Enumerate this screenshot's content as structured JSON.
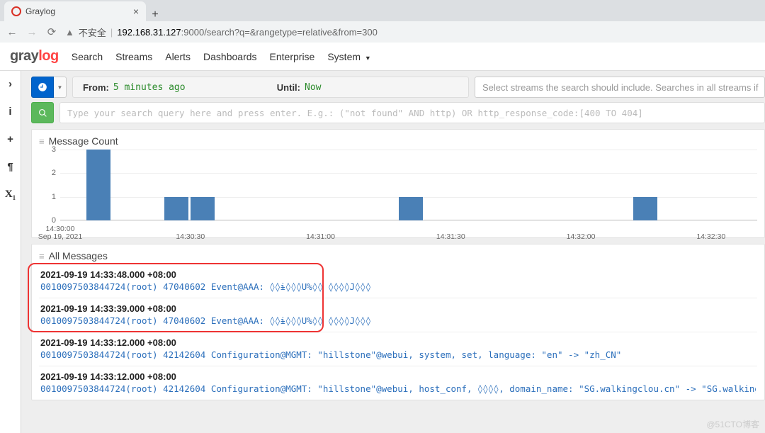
{
  "browser": {
    "tab_title": "Graylog",
    "security_label": "不安全",
    "url_host": "192.168.31.127",
    "url_port_path": ":9000/search?q=&rangetype=relative&from=300"
  },
  "brand": {
    "part1": "gray",
    "part2": "log"
  },
  "nav": {
    "search": "Search",
    "streams": "Streams",
    "alerts": "Alerts",
    "dashboards": "Dashboards",
    "enterprise": "Enterprise",
    "system": "System"
  },
  "timerange": {
    "from_label": "From:",
    "from_value": "5 minutes ago",
    "until_label": "Until:",
    "until_value": "Now"
  },
  "streams_placeholder": "Select streams the search should include. Searches in all streams if",
  "query_placeholder": "Type your search query here and press enter. E.g.: (\"not found\" AND http) OR http_response_code:[400 TO 404]",
  "panels": {
    "message_count": "Message Count",
    "all_messages": "All Messages"
  },
  "chart_data": {
    "type": "bar",
    "title": "Message Count",
    "ylabel": "",
    "ylim": [
      0,
      3
    ],
    "yticks": [
      0,
      1,
      2,
      3
    ],
    "x_date": "Sep 19, 2021",
    "xticks": [
      "14:30:00",
      "14:30:30",
      "14:31:00",
      "14:31:30",
      "14:32:00",
      "14:32:30"
    ],
    "bars": [
      {
        "x": "14:30:06",
        "value": 3
      },
      {
        "x": "14:30:24",
        "value": 1
      },
      {
        "x": "14:30:30",
        "value": 1
      },
      {
        "x": "14:31:18",
        "value": 1
      },
      {
        "x": "14:32:12",
        "value": 1
      }
    ]
  },
  "messages": [
    {
      "ts": "2021-09-19 14:33:48.000 +08:00",
      "body": "0010097503844724(root) 47040602 Event@AAA: ◊◊ɨ◊◊◊U%◊◊ ◊◊◊◊J◊◊◊"
    },
    {
      "ts": "2021-09-19 14:33:39.000 +08:00",
      "body": "0010097503844724(root) 47040602 Event@AAA: ◊◊ɨ◊◊◊U%◊◊ ◊◊◊◊J◊◊◊"
    },
    {
      "ts": "2021-09-19 14:33:12.000 +08:00",
      "body": "0010097503844724(root) 42142604 Configuration@MGMT: \"hillstone\"@webui, system, set, language: \"en\" -> \"zh_CN\""
    },
    {
      "ts": "2021-09-19 14:33:12.000 +08:00",
      "body": "0010097503844724(root) 42142604 Configuration@MGMT: \"hillstone\"@webui, host_conf, ◊◊◊◊, domain_name: \"SG.walkingclou.cn\" -> \"SG.walkingcloud.cn\""
    }
  ],
  "watermark": "@51CTO博客"
}
